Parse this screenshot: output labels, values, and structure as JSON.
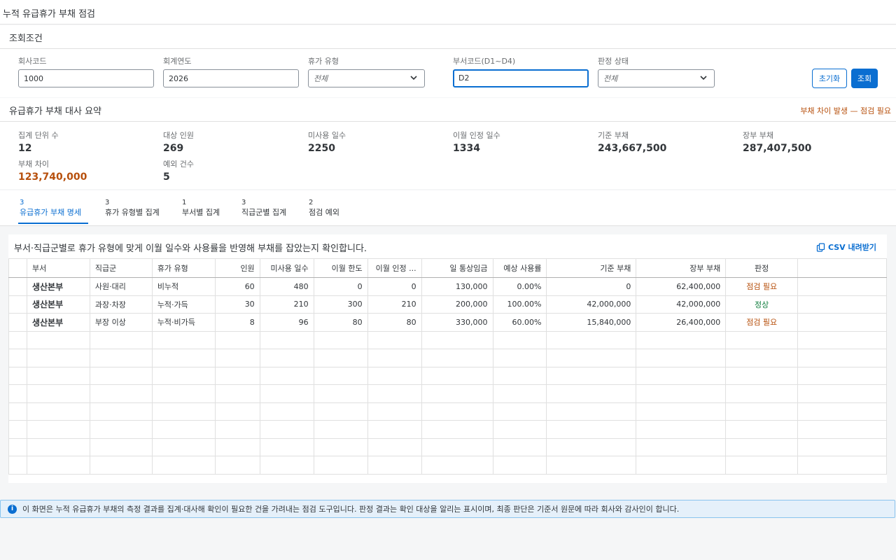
{
  "app": {
    "title": "누적 유급휴가 부채 점검"
  },
  "filter": {
    "section_title": "조회조건",
    "company": {
      "label": "회사코드",
      "value": "1000"
    },
    "fiscal_year": {
      "label": "회계연도",
      "value": "2026"
    },
    "leave_type": {
      "label": "휴가 유형",
      "placeholder": "전체"
    },
    "dept_code": {
      "label": "부서코드(D1~D4)",
      "value": "D2"
    },
    "status": {
      "label": "판정 상태",
      "placeholder": "전체"
    },
    "reset_label": "초기화",
    "search_label": "조회"
  },
  "summary": {
    "section_title": "유급휴가 부채 대사 요약",
    "warning": "부채 차이 발생 — 점검 필요",
    "kpis": [
      {
        "label": "집계 단위 수",
        "value": "12"
      },
      {
        "label": "대상 인원",
        "value": "269"
      },
      {
        "label": "미사용 일수",
        "value": "2250"
      },
      {
        "label": "이월 인정 일수",
        "value": "1334"
      },
      {
        "label": "기준 부채",
        "value": "243,667,500"
      },
      {
        "label": "장부 부채",
        "value": "287,407,500"
      },
      {
        "label": "부채 차이",
        "value": "123,740,000"
      },
      {
        "label": "예외 건수",
        "value": "5"
      }
    ]
  },
  "tabs": [
    {
      "count": "3",
      "label": "유급휴가 부채 명세"
    },
    {
      "count": "3",
      "label": "휴가 유형별 집계"
    },
    {
      "count": "1",
      "label": "부서별 집계"
    },
    {
      "count": "3",
      "label": "직급군별 집계"
    },
    {
      "count": "2",
      "label": "점검 예외"
    }
  ],
  "panel": {
    "description": "부서·직급군별로 휴가 유형에 맞게 이월 일수와 사용률을 반영해 부채를 잡았는지 확인합니다.",
    "csv_label": "CSV 내려받기"
  },
  "table": {
    "headers": [
      "부서",
      "직급군",
      "휴가 유형",
      "인원",
      "미사용 일수",
      "이월 한도",
      "이월 인정 ...",
      "일 통상임금",
      "예상 사용률",
      "기준 부채",
      "장부 부채",
      "판정"
    ],
    "rows": [
      [
        "생산본부",
        "사원·대리",
        "비누적",
        "60",
        "480",
        "0",
        "0",
        "130,000",
        "0.00%",
        "0",
        "62,400,000",
        "점검 필요"
      ],
      [
        "생산본부",
        "과장·차장",
        "누적·가득",
        "30",
        "210",
        "300",
        "210",
        "200,000",
        "100.00%",
        "42,000,000",
        "42,000,000",
        "정상"
      ],
      [
        "생산본부",
        "부장 이상",
        "누적·비가득",
        "8",
        "96",
        "80",
        "80",
        "330,000",
        "60.00%",
        "15,840,000",
        "26,400,000",
        "점검 필요"
      ]
    ]
  },
  "footer_info": "이 화면은 누적 유급휴가 부채의 측정 결과를 집계·대사해 확인이 필요한 건을 가려내는 점검 도구입니다. 판정 결과는 확인 대상을 알리는 표시이며, 최종 판단은 기준서 원문에 따라 회사와 감사인이 합니다.",
  "colors": {
    "accent": "#0a6ed1",
    "warning": "#b7500d",
    "success": "#107e3e"
  }
}
